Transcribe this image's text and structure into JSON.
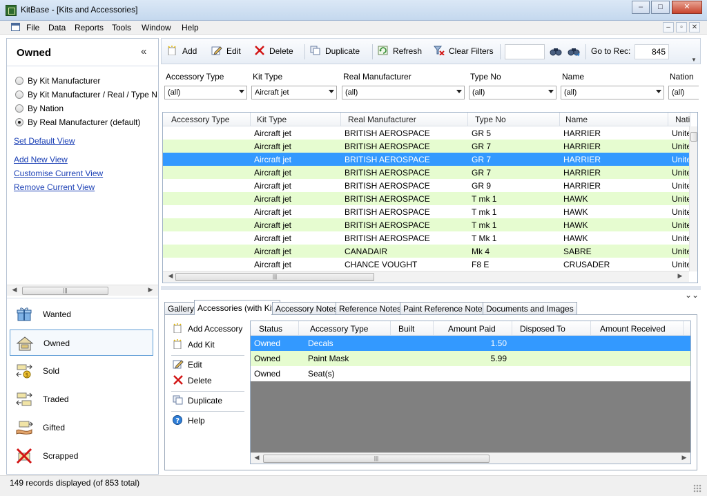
{
  "window": {
    "title": "KitBase - [Kits and Accessories]",
    "minimize": "–",
    "maximize": "□",
    "close": "✕"
  },
  "menu": [
    "File",
    "Data",
    "Reports",
    "Tools",
    "Window",
    "Help"
  ],
  "mdi_buttons": [
    "–",
    "▫",
    "✕"
  ],
  "left": {
    "title": "Owned",
    "collapse": "«",
    "views": [
      {
        "label": "By Kit Manufacturer",
        "selected": false
      },
      {
        "label": "By Kit Manufacturer / Real / Type No / Name",
        "selected": false
      },
      {
        "label": "By Nation",
        "selected": false
      },
      {
        "label": "By Real Manufacturer (default)",
        "selected": true
      }
    ],
    "links": [
      "Set Default View",
      "Add New View",
      "Customise Current View",
      "Remove Current View"
    ],
    "nav": [
      {
        "label": "Wanted",
        "icon": "gift-icon",
        "selected": false
      },
      {
        "label": "Owned",
        "icon": "house-icon",
        "selected": true
      },
      {
        "label": "Sold",
        "icon": "sold-icon",
        "selected": false
      },
      {
        "label": "Traded",
        "icon": "traded-icon",
        "selected": false
      },
      {
        "label": "Gifted",
        "icon": "gifted-icon",
        "selected": false
      },
      {
        "label": "Scrapped",
        "icon": "scrapped-icon",
        "selected": false
      }
    ]
  },
  "toolbar": {
    "add": "Add",
    "edit": "Edit",
    "delete": "Delete",
    "duplicate": "Duplicate",
    "refresh": "Refresh",
    "clear_filters": "Clear Filters",
    "search_value": "",
    "goto_label": "Go to Rec:",
    "goto_value": "845"
  },
  "filters": [
    {
      "label": "Accessory Type",
      "value": "(all)"
    },
    {
      "label": "Kit Type",
      "value": "Aircraft jet"
    },
    {
      "label": "Real Manufacturer",
      "value": "(all)"
    },
    {
      "label": "Type No",
      "value": "(all)"
    },
    {
      "label": "Name",
      "value": "(all)"
    },
    {
      "label": "Nation",
      "value": "(all)"
    }
  ],
  "grid": {
    "columns": [
      "Accessory Type",
      "Kit Type",
      "Real Manufacturer",
      "Type No",
      "Name",
      "Nation"
    ],
    "rows": [
      {
        "accessory": "",
        "kit_type": "Aircraft jet",
        "manufacturer": "BRITISH AEROSPACE",
        "type_no": "GR 5",
        "name": "HARRIER",
        "nation": "United Kingdom"
      },
      {
        "accessory": "",
        "kit_type": "Aircraft jet",
        "manufacturer": "BRITISH AEROSPACE",
        "type_no": "GR 7",
        "name": "HARRIER",
        "nation": "United Kingdom"
      },
      {
        "accessory": "",
        "kit_type": "Aircraft jet",
        "manufacturer": "BRITISH AEROSPACE",
        "type_no": "GR 7",
        "name": "HARRIER",
        "nation": "United Kingdom"
      },
      {
        "accessory": "",
        "kit_type": "Aircraft jet",
        "manufacturer": "BRITISH AEROSPACE",
        "type_no": "GR 7",
        "name": "HARRIER",
        "nation": "United Kingdom"
      },
      {
        "accessory": "",
        "kit_type": "Aircraft jet",
        "manufacturer": "BRITISH AEROSPACE",
        "type_no": "GR 9",
        "name": "HARRIER",
        "nation": "United Kingdom"
      },
      {
        "accessory": "",
        "kit_type": "Aircraft jet",
        "manufacturer": "BRITISH AEROSPACE",
        "type_no": "T mk 1",
        "name": "HAWK",
        "nation": "United Kingdom"
      },
      {
        "accessory": "",
        "kit_type": "Aircraft jet",
        "manufacturer": "BRITISH AEROSPACE",
        "type_no": "T mk 1",
        "name": "HAWK",
        "nation": "United Kingdom"
      },
      {
        "accessory": "",
        "kit_type": "Aircraft jet",
        "manufacturer": "BRITISH AEROSPACE",
        "type_no": "T mk 1",
        "name": "HAWK",
        "nation": "United Kingdom"
      },
      {
        "accessory": "",
        "kit_type": "Aircraft jet",
        "manufacturer": "BRITISH AEROSPACE",
        "type_no": "T Mk 1",
        "name": "HAWK",
        "nation": "United Kingdom"
      },
      {
        "accessory": "",
        "kit_type": "Aircraft jet",
        "manufacturer": "CANADAIR",
        "type_no": "Mk 4",
        "name": "SABRE",
        "nation": "United Kingdom"
      },
      {
        "accessory": "",
        "kit_type": "Aircraft jet",
        "manufacturer": "CHANCE VOUGHT",
        "type_no": "F8 E",
        "name": "CRUSADER",
        "nation": "United States"
      }
    ],
    "selected_row": 2
  },
  "tabs": [
    "Gallery",
    "Accessories (with Kit)",
    "Accessory Notes",
    "Reference Notes",
    "Paint Reference Notes",
    "Documents and Images"
  ],
  "active_tab": 1,
  "detail_actions": {
    "add_accessory": "Add Accessory",
    "add_kit": "Add Kit",
    "edit": "Edit",
    "delete": "Delete",
    "duplicate": "Duplicate",
    "help": "Help"
  },
  "detail": {
    "columns": [
      "Status",
      "Accessory Type",
      "Built",
      "Amount Paid",
      "Disposed To",
      "Amount Received"
    ],
    "rows": [
      {
        "status": "Owned",
        "type": "Decals",
        "built": "",
        "paid": "1.50",
        "disposed": "",
        "received": ""
      },
      {
        "status": "Owned",
        "type": "Paint Mask",
        "built": "",
        "paid": "5.99",
        "disposed": "",
        "received": ""
      },
      {
        "status": "Owned",
        "type": "Seat(s)",
        "built": "",
        "paid": "",
        "disposed": "",
        "received": ""
      }
    ]
  },
  "status": "149 records displayed (of 853 total)",
  "colors": {
    "selection": "#3399ff",
    "alt_row": "#e6fcd0",
    "link": "#1a3fb5"
  }
}
